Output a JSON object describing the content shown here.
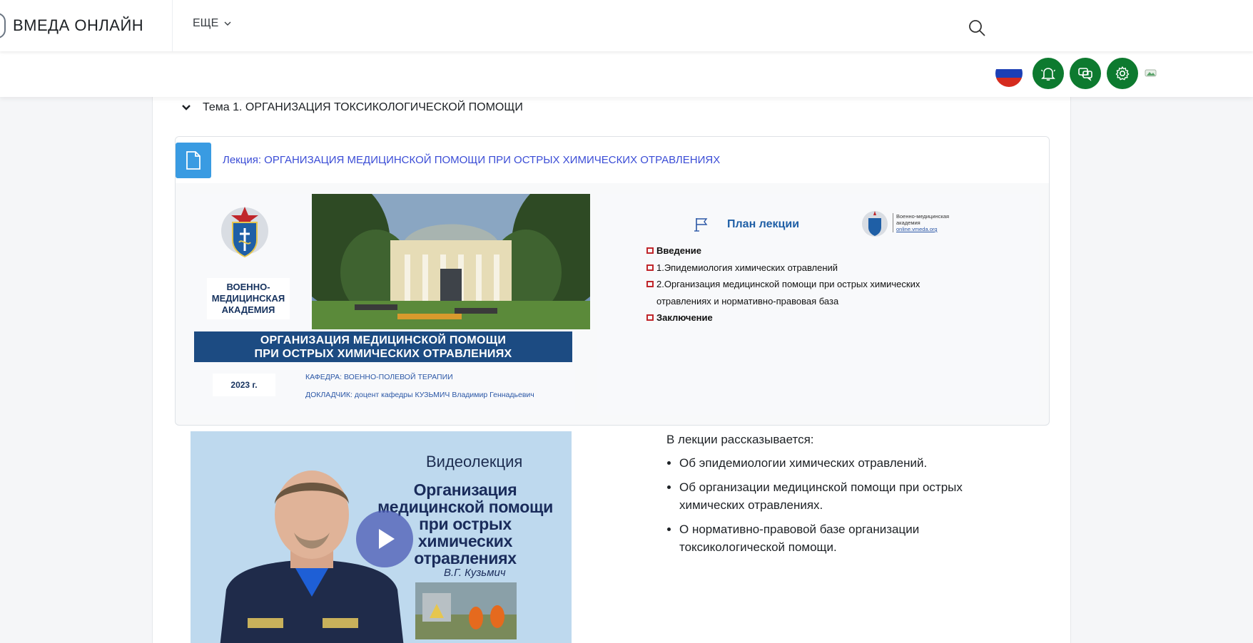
{
  "header": {
    "brand_title": "ВМЕДА ОНЛАЙН",
    "more_label": "ЕЩЕ"
  },
  "section": {
    "title": "Тема 1. ОРГАНИЗАЦИЯ ТОКСИКОЛОГИЧЕСКОЙ ПОМОЩИ"
  },
  "activity": {
    "link_text": "Лекция: ОРГАНИЗАЦИЯ МЕДИЦИНСКОЙ ПОМОЩИ ПРИ ОСТРЫХ ХИМИЧЕСКИХ ОТРАВЛЕНИЯХ"
  },
  "slide1": {
    "academy_line1": "ВОЕННО-",
    "academy_line2": "МЕДИЦИНСКАЯ",
    "academy_line3": "АКАДЕМИЯ",
    "banner_line1": "ОРГАНИЗАЦИЯ МЕДИЦИНСКОЙ ПОМОЩИ",
    "banner_line2": "ПРИ ОСТРЫХ ХИМИЧЕСКИХ ОТРАВЛЕНИЯХ",
    "year": "2023 г.",
    "department": "КАФЕДРА: ВОЕННО-ПОЛЕВОЙ ТЕРАПИИ",
    "speaker": "ДОКЛАДЧИК: доцент кафедры КУЗЬМИЧ Владимир Геннадьевич"
  },
  "slide2": {
    "title": "План лекции",
    "logo_line1": "Военно-медицинская",
    "logo_line2": "академия",
    "logo_url": "online.vmeda.org",
    "items": [
      {
        "text": "Введение",
        "bold": true
      },
      {
        "text": "1.Эпидемиология химических отравлений",
        "bold": false
      },
      {
        "text": "2.Организация медицинской помощи при острых химических отравлениях и нормативно-правовая база",
        "bold": false
      },
      {
        "text": "Заключение",
        "bold": true
      }
    ]
  },
  "video": {
    "label": "Видеолекция",
    "title_line1": "Организация",
    "title_line2": "медицинской помощи",
    "title_line3": "при острых",
    "title_line4": "химических",
    "title_line5": "отравлениях",
    "author": "В.Г. Кузьмич"
  },
  "description": {
    "intro": "В лекции рассказывается:",
    "items": [
      "Об эпидемиологии химических отравлений.",
      "Об организации медицинской помощи при острых химических отравлениях.",
      "О нормативно-правовой базе организации токсикологической помощи."
    ]
  },
  "colors": {
    "accent_green": "#0d7a2f",
    "link_blue": "#3b4dd6",
    "doc_icon_blue": "#399be2",
    "banner_navy": "#1c4b82"
  },
  "icons": {
    "search": "search-icon",
    "notifications": "bell-icon",
    "messages": "chat-icon",
    "settings": "gear-icon",
    "language": "russia-flag-icon",
    "document": "document-icon",
    "collapse": "chevron-down-icon",
    "play": "play-icon"
  }
}
